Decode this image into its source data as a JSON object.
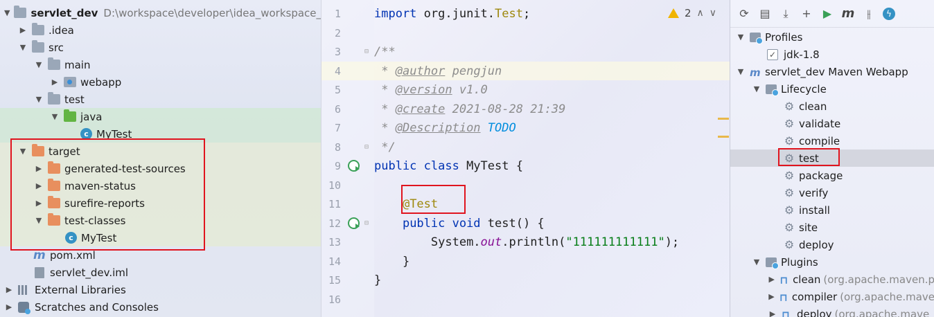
{
  "project": {
    "rows": [
      {
        "name": "servlet_dev",
        "path": "D:\\workspace\\developer\\idea_workspace_pa"
      },
      {
        "name": ".idea"
      },
      {
        "name": "src"
      },
      {
        "name": "main"
      },
      {
        "name": "webapp"
      },
      {
        "name": "test"
      },
      {
        "name": "java"
      },
      {
        "name": "MyTest"
      },
      {
        "name": "target"
      },
      {
        "name": "generated-test-sources"
      },
      {
        "name": "maven-status"
      },
      {
        "name": "surefire-reports"
      },
      {
        "name": "test-classes"
      },
      {
        "name": "MyTest"
      },
      {
        "name": "pom.xml"
      },
      {
        "name": "servlet_dev.iml"
      },
      {
        "name": "External Libraries"
      },
      {
        "name": "Scratches and Consoles"
      }
    ]
  },
  "editor": {
    "warnings": "2",
    "lines": [
      {
        "n": "1"
      },
      {
        "n": "2"
      },
      {
        "n": "3"
      },
      {
        "n": "4"
      },
      {
        "n": "5"
      },
      {
        "n": "6"
      },
      {
        "n": "7"
      },
      {
        "n": "8"
      },
      {
        "n": "9"
      },
      {
        "n": "10"
      },
      {
        "n": "11"
      },
      {
        "n": "12"
      },
      {
        "n": "13"
      },
      {
        "n": "14"
      },
      {
        "n": "15"
      },
      {
        "n": "16"
      }
    ],
    "code": {
      "import_kw": "import",
      "import_pkg": " org.junit.",
      "import_cls": "Test",
      "import_end": ";",
      "jd_open": "/**",
      "jd_star": " * ",
      "author_tag": "@author",
      "author_val": " pengjun",
      "version_tag": "@version",
      "version_val": " v1.0",
      "create_tag": "@create",
      "create_val": " 2021-08-28 21:39",
      "desc_tag": "@Description",
      "desc_val": "TODO",
      "jd_close": " */",
      "class_kw": "public class",
      "class_name": " MyTest {",
      "test_ann": "@Test",
      "method_kw": "public void",
      "method_name": " test() {",
      "sys": "System.",
      "out": "out",
      "println": ".println(",
      "str": "\"111111111111\"",
      "println_end": ");",
      "close_method": "}",
      "close_class": "}"
    }
  },
  "maven": {
    "rows": [
      {
        "label": "Profiles"
      },
      {
        "label": "jdk-1.8"
      },
      {
        "label": "servlet_dev Maven Webapp"
      },
      {
        "label": "Lifecycle"
      },
      {
        "label": "clean"
      },
      {
        "label": "validate"
      },
      {
        "label": "compile"
      },
      {
        "label": "test"
      },
      {
        "label": "package"
      },
      {
        "label": "verify"
      },
      {
        "label": "install"
      },
      {
        "label": "site"
      },
      {
        "label": "deploy"
      },
      {
        "label": "Plugins"
      },
      {
        "label": "clean",
        "meta": "(org.apache.maven.p"
      },
      {
        "label": "compiler",
        "meta": "(org.apache.mave"
      },
      {
        "label": "deploy",
        "meta": "(org.apache.mave"
      }
    ]
  }
}
